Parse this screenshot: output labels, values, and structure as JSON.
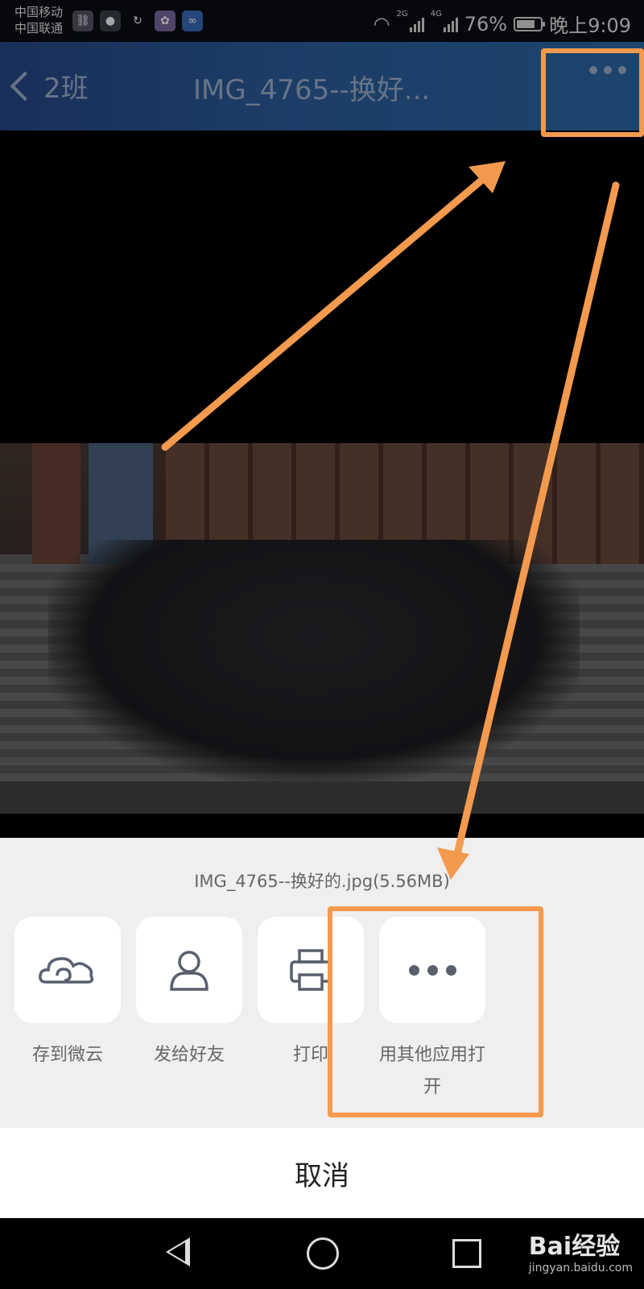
{
  "status_bar": {
    "carrier_1": "中国移动",
    "carrier_2": "中国联通",
    "net_1": "2G",
    "net_2": "4G",
    "battery": "76%",
    "time": "晚上9:09"
  },
  "header": {
    "back_label": "2班",
    "title": "IMG_4765--换好..."
  },
  "share_sheet": {
    "filename": "IMG_4765--换好的.jpg(5.56MB)",
    "actions": [
      {
        "label": "存到微云",
        "icon": "cloud-icon"
      },
      {
        "label": "发给好友",
        "icon": "person-icon"
      },
      {
        "label": "打印",
        "icon": "printer-icon"
      },
      {
        "label": "用其他应用打开",
        "icon": "more-dots-icon"
      }
    ],
    "cancel_label": "取消"
  },
  "watermark": {
    "brand": "Bai经验",
    "url": "jingyan.baidu.com"
  },
  "colors": {
    "header_bg": "#2b5f9e",
    "annotation": "#f39a4e",
    "sheet_bg": "#efefef"
  }
}
